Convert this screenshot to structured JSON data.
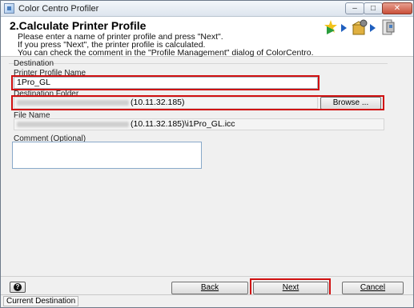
{
  "window": {
    "title": "Color Centro Profiler",
    "minimize": "–",
    "maximize": "□",
    "close": "✕"
  },
  "header": {
    "title": "2.Calculate Printer Profile",
    "lines": [
      "Please enter a name of printer profile and press \"Next\".",
      "If you press \"Next\", the printer profile is calculated.",
      "You can check the comment in the \"Profile Management\" dialog of ColorCentro."
    ],
    "step_icons": [
      "sparkle-arrow-icon",
      "package-gear-icon",
      "printer-profile-icon"
    ]
  },
  "destination": {
    "group_label": "Destination",
    "profile_name_label": "Printer Profile Name",
    "profile_name_value": "1Pro_GL",
    "folder_label": "Destination Folder",
    "folder_value": "(10.11.32.185)",
    "browse_label": "Browse ...",
    "file_name_label": "File Name",
    "file_name_value": "(10.11.32.185)\\i1Pro_GL.icc"
  },
  "comment": {
    "label": "Comment (Optional)",
    "value": ""
  },
  "footer": {
    "help_label": "?",
    "back_label": "Back",
    "next_label": "Next",
    "cancel_label": "Cancel"
  },
  "status": {
    "current": "Current Destination"
  },
  "colors": {
    "highlight": "#d01010",
    "arrow": "#1f5fbf"
  }
}
